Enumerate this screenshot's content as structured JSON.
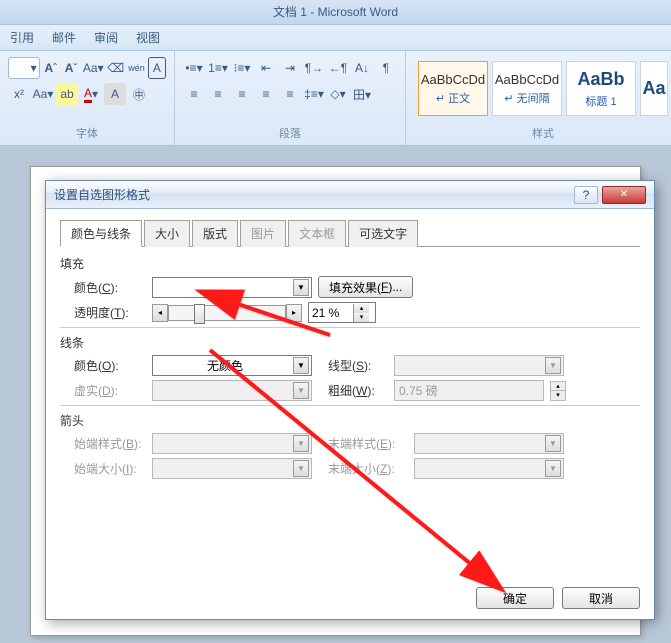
{
  "app": {
    "title": "文档 1 - Microsoft Word"
  },
  "menu": {
    "items": [
      "引用",
      "邮件",
      "审阅",
      "视图"
    ]
  },
  "ribbon": {
    "font_label": "字体",
    "para_label": "段落",
    "styles_label": "样式",
    "styles": [
      {
        "sample": "AaBbCcDd",
        "name": "↵ 正文"
      },
      {
        "sample": "AaBbCcDd",
        "name": "↵ 无间隔"
      },
      {
        "sample": "AaBb",
        "name": "标题 1"
      },
      {
        "sample": "Aa",
        "name": ""
      }
    ]
  },
  "dialog": {
    "title": "设置自选图形格式",
    "tabs": [
      "颜色与线条",
      "大小",
      "版式",
      "图片",
      "文本框",
      "可选文字"
    ],
    "active_tab": 0,
    "disabled_tabs": [
      3,
      4
    ],
    "fill": {
      "legend": "填充",
      "color_label": "颜色(C):",
      "fill_effects_btn": "填充效果(F)...",
      "transparency_label": "透明度(T):",
      "transparency_value": "21 %"
    },
    "line": {
      "legend": "线条",
      "color_label": "颜色(O):",
      "color_value": "无颜色",
      "style_label": "线型(S):",
      "dash_label": "虚实(D):",
      "weight_label": "粗细(W):",
      "weight_value": "0.75 磅"
    },
    "arrow": {
      "legend": "箭头",
      "begin_style_label": "始端样式(B):",
      "end_style_label": "末端样式(E):",
      "begin_size_label": "始端大小(I):",
      "end_size_label": "末端大小(Z):"
    },
    "ok": "确定",
    "cancel": "取消"
  }
}
